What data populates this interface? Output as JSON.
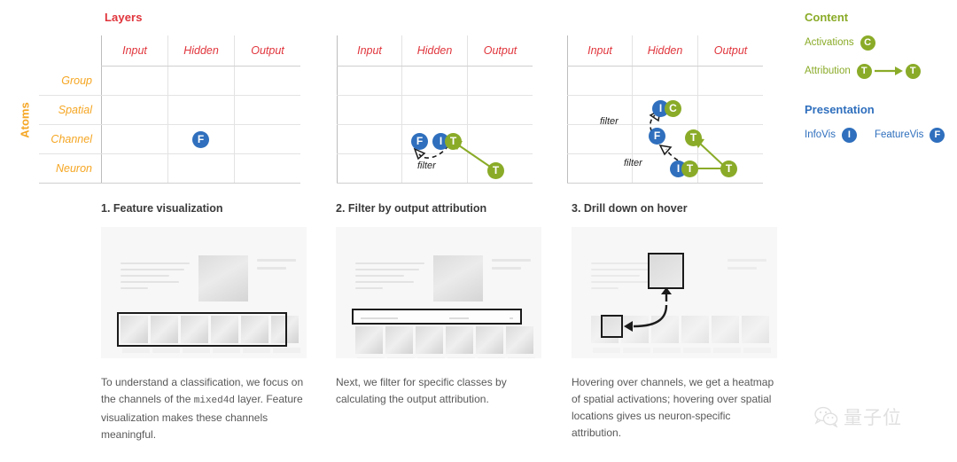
{
  "diagram": {
    "axis_titles": {
      "columns": "Layers",
      "rows": "Atoms"
    },
    "columns": [
      "Input",
      "Hidden",
      "Output"
    ],
    "rows": [
      "Group",
      "Spatial",
      "Channel",
      "Neuron"
    ],
    "filter_label": "filter",
    "grids": [
      {
        "id": "grid-1",
        "badges": [
          {
            "label": "F",
            "kind": "blue",
            "row": "Channel",
            "col": "Hidden"
          }
        ],
        "filters": [],
        "arrows": []
      },
      {
        "id": "grid-2",
        "badges": [
          {
            "label": "F",
            "kind": "blue",
            "row": "Channel",
            "col": "Hidden"
          },
          {
            "label": "I",
            "kind": "blue",
            "row": "Channel",
            "col": "Hidden"
          },
          {
            "label": "T",
            "kind": "green",
            "row": "Channel",
            "col": "Hidden"
          },
          {
            "label": "T",
            "kind": "green",
            "row": "Neuron",
            "col": "Output"
          }
        ],
        "filters": [
          "filter"
        ],
        "arrows": [
          {
            "kind": "attribution",
            "from": "Output T",
            "to": "Hidden T"
          },
          {
            "kind": "filter-dashed",
            "from": "Hidden T",
            "to": "Hidden F"
          }
        ]
      },
      {
        "id": "grid-3",
        "badges": [
          {
            "label": "I",
            "kind": "blue",
            "row": "Spatial",
            "col": "Hidden"
          },
          {
            "label": "C",
            "kind": "green",
            "row": "Spatial",
            "col": "Hidden"
          },
          {
            "label": "F",
            "kind": "blue",
            "row": "Channel",
            "col": "Hidden"
          },
          {
            "label": "T",
            "kind": "green",
            "row": "Channel",
            "col": "Hidden"
          },
          {
            "label": "I",
            "kind": "blue",
            "row": "Neuron",
            "col": "Hidden"
          },
          {
            "label": "T",
            "kind": "green",
            "row": "Neuron",
            "col": "Hidden"
          },
          {
            "label": "T",
            "kind": "green",
            "row": "Neuron",
            "col": "Output"
          }
        ],
        "filters": [
          "filter",
          "filter"
        ],
        "arrows": [
          {
            "kind": "attribution",
            "from": "Output T",
            "to": "Channel T"
          },
          {
            "kind": "attribution",
            "from": "Output T",
            "to": "Neuron T"
          },
          {
            "kind": "filter-dashed",
            "from": "Channel F",
            "to": "Spatial I"
          },
          {
            "kind": "filter-dashed",
            "from": "Neuron T",
            "to": "Channel F"
          }
        ]
      }
    ]
  },
  "legend": {
    "content": {
      "heading": "Content",
      "items": [
        {
          "label": "Activations",
          "badges": [
            {
              "label": "C",
              "kind": "green"
            }
          ],
          "arrow": false
        },
        {
          "label": "Attribution",
          "badges": [
            {
              "label": "T",
              "kind": "green"
            },
            {
              "label": "T",
              "kind": "green"
            }
          ],
          "arrow": true
        }
      ]
    },
    "presentation": {
      "heading": "Presentation",
      "items": [
        {
          "label": "InfoVis",
          "badges": [
            {
              "label": "I",
              "kind": "blue"
            }
          ]
        },
        {
          "label": "FeatureVis",
          "badges": [
            {
              "label": "F",
              "kind": "blue"
            }
          ]
        }
      ]
    }
  },
  "panels": [
    {
      "title": "1. Feature visualization",
      "caption_pre": "To understand a classification, we focus on the channels of the ",
      "caption_code": "mixed4d",
      "caption_post": " layer. Feature visualization makes these channels meaningful."
    },
    {
      "title": "2. Filter by output attribution",
      "caption_pre": "Next, we filter for specific classes by calculating the output attribution.",
      "caption_code": "",
      "caption_post": ""
    },
    {
      "title": "3. Drill down on hover",
      "caption_pre": "Hovering over channels, we get a heatmap of spatial activations; hovering over spatial locations gives us neuron-specific attribution.",
      "caption_code": "",
      "caption_post": ""
    }
  ],
  "watermark": {
    "text": "量子位",
    "icon": "wechat-icon"
  },
  "colors": {
    "layers_red": "#e0353c",
    "atoms_orange": "#f5a623",
    "content_green": "#8aab28",
    "presentation_blue": "#2f6fbd",
    "panel_title": "#3a3a3a",
    "caption_gray": "#585858"
  }
}
